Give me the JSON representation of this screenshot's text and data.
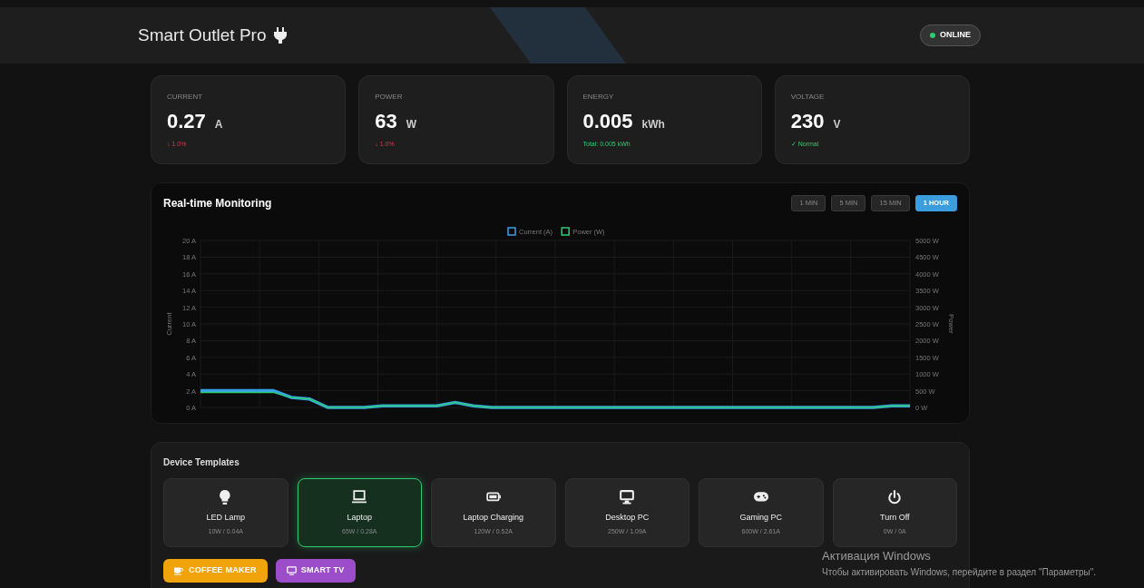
{
  "header": {
    "title": "Smart Outlet Pro",
    "status": "ONLINE"
  },
  "metrics": [
    {
      "kind": "alert",
      "label": "CURRENT",
      "value": "0.27",
      "unit": "A",
      "note": "↓ 1.0%"
    },
    {
      "kind": "alert",
      "label": "POWER",
      "value": "63",
      "unit": "W",
      "note": "↓ 1.0%"
    },
    {
      "kind": "ok",
      "label": "ENERGY",
      "value": "0.005",
      "unit": "kWh",
      "note": "Total: 0.005 kWh"
    },
    {
      "kind": "ok",
      "label": "VOLTAGE",
      "value": "230",
      "unit": "V",
      "note": "✓ Normal"
    }
  ],
  "monitoring": {
    "title": "Real-time Monitoring",
    "ranges": [
      {
        "label": "1 MIN",
        "selected": false
      },
      {
        "label": "5 MIN",
        "selected": false
      },
      {
        "label": "15 MIN",
        "selected": false
      },
      {
        "label": "1 HOUR",
        "selected": true
      }
    ],
    "chart_data": {
      "type": "line",
      "ylabel": "Current",
      "y2label": "Power",
      "grid": true,
      "legend": "top",
      "ylim": [
        0,
        20
      ],
      "yticks": [
        {
          "value": 0,
          "label": "0 A"
        },
        {
          "value": 2,
          "label": "2 A"
        },
        {
          "value": 4,
          "label": "4 A"
        },
        {
          "value": 6,
          "label": "6 A"
        },
        {
          "value": 8,
          "label": "8 A"
        },
        {
          "value": 10,
          "label": "10 A"
        },
        {
          "value": 12,
          "label": "12 A"
        },
        {
          "value": 14,
          "label": "14 A"
        },
        {
          "value": 16,
          "label": "16 A"
        },
        {
          "value": 18,
          "label": "18 A"
        },
        {
          "value": 20,
          "label": "20 A"
        }
      ],
      "y2lim": [
        0,
        5000
      ],
      "y2ticks": [
        {
          "value": 0,
          "label": "0 W"
        },
        {
          "value": 500,
          "label": "500 W"
        },
        {
          "value": 1000,
          "label": "1000 W"
        },
        {
          "value": 1500,
          "label": "1500 W"
        },
        {
          "value": 2000,
          "label": "2000 W"
        },
        {
          "value": 2500,
          "label": "2500 W"
        },
        {
          "value": 3000,
          "label": "3000 W"
        },
        {
          "value": 3500,
          "label": "3500 W"
        },
        {
          "value": 4000,
          "label": "4000 W"
        },
        {
          "value": 4500,
          "label": "4500 W"
        },
        {
          "value": 5000,
          "label": "5000 W"
        }
      ],
      "series": [
        {
          "name": "Current (A)",
          "color": "#36a2eb",
          "values": [
            2.0,
            2.0,
            2.0,
            2.0,
            2.0,
            1.2,
            1.0,
            0.0,
            0,
            0,
            0.2,
            0.2,
            0.2,
            0.2,
            0.6,
            0.2,
            0.0,
            0,
            0,
            0,
            0,
            0,
            0,
            0,
            0,
            0,
            0,
            0,
            0,
            0,
            0,
            0,
            0,
            0,
            0,
            0,
            0,
            0,
            0.2,
            0.2
          ]
        },
        {
          "name": "Power (W)",
          "color": "#2ecc71",
          "axis": "y2",
          "values": [
            450,
            450,
            450,
            450,
            450,
            300,
            250,
            0,
            0,
            0,
            50,
            50,
            50,
            50,
            150,
            50,
            0,
            0,
            0,
            0,
            0,
            0,
            0,
            0,
            0,
            0,
            0,
            0,
            0,
            0,
            0,
            0,
            0,
            0,
            0,
            0,
            0,
            0,
            50,
            50
          ]
        }
      ]
    }
  },
  "templates": {
    "title": "Device Templates",
    "devices": [
      {
        "name": "LED Lamp",
        "spec": "10W / 0.04A",
        "selected": false
      },
      {
        "name": "Laptop",
        "spec": "65W / 0.28A",
        "selected": true
      },
      {
        "name": "Laptop Charging",
        "spec": "120W / 0.52A",
        "selected": false
      },
      {
        "name": "Desktop PC",
        "spec": "250W / 1.09A",
        "selected": false
      },
      {
        "name": "Gaming PC",
        "spec": "600W / 2.61A",
        "selected": false
      },
      {
        "name": "Turn Off",
        "spec": "0W / 0A",
        "selected": false
      }
    ],
    "extra": [
      {
        "label": "COFFEE MAKER",
        "color": "#f0a30a"
      },
      {
        "label": "SMART TV",
        "color": "#9b4dca"
      }
    ]
  },
  "os_notice": {
    "title": "Активация Windows",
    "text": "Чтобы активировать Windows, перейдите в раздел \"Параметры\"."
  }
}
